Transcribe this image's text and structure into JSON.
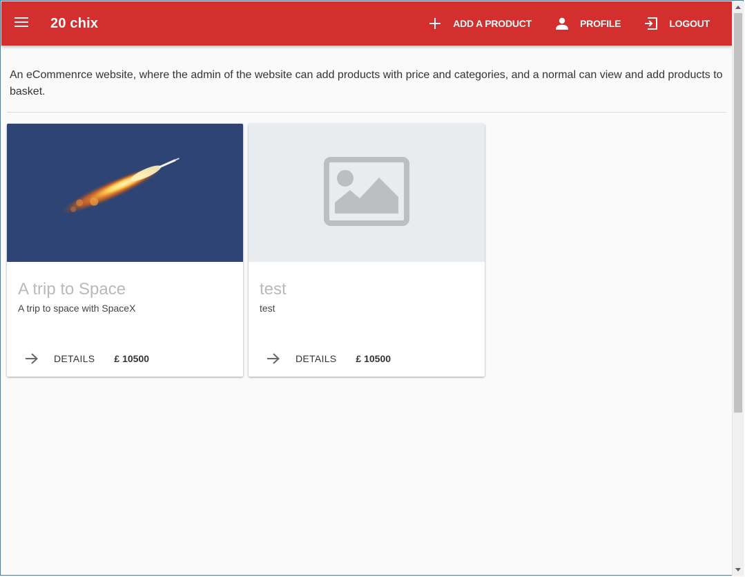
{
  "header": {
    "title": "20 chix",
    "add_product_label": "ADD A PRODUCT",
    "profile_label": "PROFILE",
    "logout_label": "LOGOUT",
    "color": "#d32f2f"
  },
  "description": "An eCommenrce website, where the admin of the website can add products with price and categories, and a normal can view and add products to basket.",
  "products": [
    {
      "title": "A trip to Space",
      "subtitle": "A trip to space with SpaceX",
      "details_label": "DETAILS",
      "price": "£ 10500",
      "image": "rocket-launch-photo"
    },
    {
      "title": "test",
      "subtitle": "test",
      "details_label": "DETAILS",
      "price": "£ 10500",
      "image": "image-placeholder-icon"
    }
  ],
  "icons": {
    "menu": "menu-icon",
    "add": "plus-icon",
    "profile": "person-icon",
    "logout": "logout-icon",
    "arrow": "arrow-right-icon"
  }
}
